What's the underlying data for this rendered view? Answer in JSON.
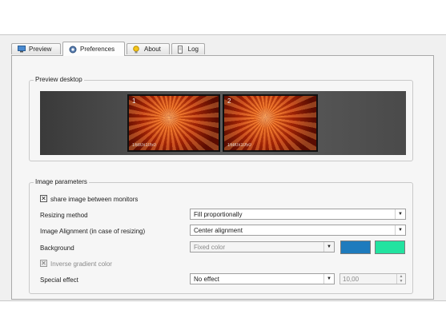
{
  "tabs": [
    {
      "label": "Preview",
      "icon": "monitor-icon",
      "active": false
    },
    {
      "label": "Preferences",
      "icon": "gear-icon",
      "active": true
    },
    {
      "label": "About",
      "icon": "lightbulb-icon",
      "active": false
    },
    {
      "label": "Log",
      "icon": "log-icon",
      "active": false
    }
  ],
  "preview": {
    "title": "Preview desktop",
    "monitors": [
      {
        "number": "1",
        "caption": "1680x1050"
      },
      {
        "number": "2",
        "caption": "1680x1050"
      }
    ]
  },
  "params": {
    "title": "Image parameters",
    "share_label": "share image between monitors",
    "share_checked": true,
    "resizing_label": "Resizing method",
    "resizing_value": "Fill proportionally",
    "alignment_label": "Image Alignment (in case of resizing)",
    "alignment_value": "Center alignment",
    "background_label": "Background",
    "background_value": "Fixed color",
    "color1": "#1e7bbd",
    "color2": "#22e3a0",
    "inverse_label": "Inverse gradient color",
    "inverse_checked": true,
    "effect_label": "Special effect",
    "effect_value": "No effect",
    "effect_amount": "10,00"
  }
}
